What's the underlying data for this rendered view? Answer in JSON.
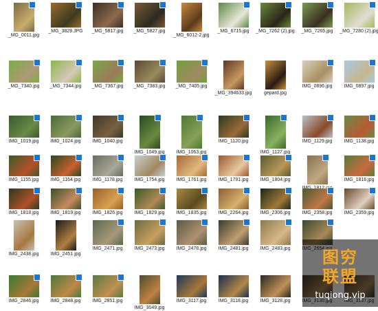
{
  "files": [
    {
      "name": "_MG_0011.jpg",
      "badge": true,
      "c1": "#7b6a45",
      "c2": "#c9ad6e"
    },
    {
      "name": "_MG_3829.JPG",
      "badge": true,
      "c1": "#9b6a2c",
      "c2": "#3c3a1f"
    },
    {
      "name": "_MG_5817.jpg",
      "badge": true,
      "c1": "#3a2f23",
      "c2": "#8d6a4c"
    },
    {
      "name": "_MG_5827.jpg",
      "badge": true,
      "c1": "#7a5a36",
      "c2": "#2a2a20"
    },
    {
      "name": "_MG_6012-2.jpg",
      "badge": false,
      "c1": "#c8893c",
      "c2": "#5b3a1d"
    },
    {
      "name": "_MG_6715.jpg",
      "badge": true,
      "c1": "#5c8a48",
      "c2": "#e8e6d8"
    },
    {
      "name": "_MG_7262 (2).jpg",
      "badge": true,
      "c1": "#6a8a3a",
      "c2": "#2a2418"
    },
    {
      "name": "_MG_7265.jpg",
      "badge": true,
      "c1": "#7a9a50",
      "c2": "#3a3020"
    },
    {
      "name": "_MG_7280 (2).jpg",
      "badge": true,
      "c1": "#a8b860",
      "c2": "#e0ddd0"
    },
    {
      "name": "_MG_7340.jpg",
      "badge": true,
      "c1": "#78b040",
      "c2": "#b09878"
    },
    {
      "name": "_MG_7344.jpg",
      "badge": true,
      "c1": "#88b84a",
      "c2": "#d8c8b8"
    },
    {
      "name": "_MG_7367.jpg",
      "badge": true,
      "c1": "#7aa848",
      "c2": "#9a7a58"
    },
    {
      "name": "_MG_7383.jpg",
      "badge": true,
      "c1": "#5a4a30",
      "c2": "#9a8a60"
    },
    {
      "name": "_MG_7405.jpg",
      "badge": true,
      "c1": "#70a040",
      "c2": "#a08a60"
    },
    {
      "name": "_MG_394633.jpg",
      "badge": false,
      "c1": "#5a3820",
      "c2": "#c89860"
    },
    {
      "name": "gepard.jpg",
      "badge": false,
      "c1": "#c89040",
      "c2": "#2a1a10"
    },
    {
      "name": "IMG_0896.jpg",
      "badge": true,
      "c1": "#d8d0c0",
      "c2": "#a89060"
    },
    {
      "name": "IMG_0897.jpg",
      "badge": true,
      "c1": "#a8c8e0",
      "c2": "#c8b890"
    },
    {
      "name": "IMG_1019.jpg",
      "badge": true,
      "c1": "#3a5a30",
      "c2": "#6a8a48"
    },
    {
      "name": "IMG_1024.jpg",
      "badge": true,
      "c1": "#4a6a38",
      "c2": "#8a9a60"
    },
    {
      "name": "IMG_1040.jpg",
      "badge": true,
      "c1": "#3a3a28",
      "c2": "#7a6040"
    },
    {
      "name": "IMG_1049.jpg",
      "badge": true,
      "c1": "#2a4a20",
      "c2": "#6a8a40"
    },
    {
      "name": "IMG_1063.jpg",
      "badge": true,
      "c1": "#4a7a30",
      "c2": "#8aa058"
    },
    {
      "name": "IMG_1120.jpg",
      "badge": true,
      "c1": "#2a3a20",
      "c2": "#9a6a38"
    },
    {
      "name": "IMG_1127.jpg",
      "badge": true,
      "c1": "#3a6a28",
      "c2": "#8ab060"
    },
    {
      "name": "IMG_1129.jpg",
      "badge": true,
      "c1": "#b8c0c8",
      "c2": "#8a4a28"
    },
    {
      "name": "IMG_1138.jpg",
      "badge": true,
      "c1": "#6a8a48",
      "c2": "#b85a30"
    },
    {
      "name": "IMG_1155.jpg",
      "badge": true,
      "c1": "#3a5a28",
      "c2": "#b8502a"
    },
    {
      "name": "IMG_1164.jpg",
      "badge": true,
      "c1": "#2a4a20",
      "c2": "#c86030"
    },
    {
      "name": "IMG_1178.jpg",
      "badge": true,
      "c1": "#6a6a60",
      "c2": "#a8a898"
    },
    {
      "name": "IMG_1754.jpg",
      "badge": true,
      "c1": "#c8d0d0",
      "c2": "#a08860"
    },
    {
      "name": "IMG_1761.jpg",
      "badge": true,
      "c1": "#a86a30",
      "c2": "#e0b880"
    },
    {
      "name": "IMG_1791.jpg",
      "badge": true,
      "c1": "#9a5a30",
      "c2": "#e8c8a0"
    },
    {
      "name": "IMG_1804.jpg",
      "badge": true,
      "c1": "#5a5a30",
      "c2": "#b89858"
    },
    {
      "name": "IMG_1812.jpg",
      "badge": true,
      "c1": "#8a7050",
      "c2": "#c0a880"
    },
    {
      "name": "IMG_1816.jpg",
      "badge": true,
      "c1": "#5a7a38",
      "c2": "#c86a40"
    },
    {
      "name": "IMG_1818.jpg",
      "badge": true,
      "c1": "#2a3a20",
      "c2": "#b05028"
    },
    {
      "name": "IMG_1819.jpg",
      "badge": true,
      "c1": "#3a5028",
      "c2": "#c88a60"
    },
    {
      "name": "IMG_1826.jpg",
      "badge": true,
      "c1": "#9a6028",
      "c2": "#d8a050"
    },
    {
      "name": "IMG_1829.jpg",
      "badge": true,
      "c1": "#3a5a28",
      "c2": "#b08858"
    },
    {
      "name": "IMG_1835.jpg",
      "badge": true,
      "c1": "#a88840",
      "c2": "#5a4a20"
    },
    {
      "name": "IMG_2264.jpg",
      "badge": true,
      "c1": "#8a6030",
      "c2": "#d8b070"
    },
    {
      "name": "IMG_2306.jpg",
      "badge": true,
      "c1": "#1a2a18",
      "c2": "#a07838"
    },
    {
      "name": "IMG_2358.jpg",
      "badge": true,
      "c1": "#4a5a30",
      "c2": "#c07848"
    },
    {
      "name": "IMG_2359.jpg",
      "badge": true,
      "c1": "#6a4a30",
      "c2": "#e0d0c0"
    },
    {
      "name": "IMG_2438.jpg",
      "badge": false,
      "c1": "#c8c0b0",
      "c2": "#a87840"
    },
    {
      "name": "IMG_2451.jpg",
      "badge": false,
      "c1": "#1a1a18",
      "c2": "#b08040"
    },
    {
      "name": "IMG_2471.jpg",
      "badge": true,
      "c1": "#5a6a50",
      "c2": "#a89878"
    },
    {
      "name": "IMG_2473.jpg",
      "badge": true,
      "c1": "#6a6a40",
      "c2": "#c8a060"
    },
    {
      "name": "IMG_2478.jpg",
      "badge": true,
      "c1": "#5a5a48",
      "c2": "#b09070"
    },
    {
      "name": "IMG_2481.jpg",
      "badge": true,
      "c1": "#3a3a30",
      "c2": "#c0a070"
    },
    {
      "name": "IMG_2483.jpg",
      "badge": true,
      "c1": "#8a7a50",
      "c2": "#d8b888"
    },
    {
      "name": "IMG_2654.jpg",
      "badge": true,
      "c1": "#3a4a30",
      "c2": "#a88858"
    },
    {
      "name": "",
      "badge": false,
      "c1": "#ffffff",
      "c2": "#ffffff"
    },
    {
      "name": "IMG_2846.jpg",
      "badge": true,
      "c1": "#3a7a30",
      "c2": "#a87838"
    },
    {
      "name": "IMG_2848.jpg",
      "badge": true,
      "c1": "#4a7a38",
      "c2": "#c08848"
    },
    {
      "name": "IMG_2851.jpg",
      "badge": true,
      "c1": "#5a7a40",
      "c2": "#c09050"
    },
    {
      "name": "IMG_3049.jpg",
      "badge": false,
      "c1": "#4a5030",
      "c2": "#c08040"
    },
    {
      "name": "IMG_3117.jpg",
      "badge": false,
      "c1": "#1a3a58",
      "c2": "#a87838"
    },
    {
      "name": "IMG_3118.jpg",
      "badge": false,
      "c1": "#1a3050",
      "c2": "#b08848"
    },
    {
      "name": "IMG_3128.jpg",
      "badge": false,
      "c1": "#2a2a20",
      "c2": "#c09058"
    },
    {
      "name": "IMG_3130.jpg",
      "badge": false,
      "c1": "#3a3a28",
      "c2": "#a88050"
    },
    {
      "name": "IMG_3137.jpg",
      "badge": false,
      "c1": "#3a3a30",
      "c2": "#a88058"
    }
  ],
  "watermark": {
    "title": "图穷",
    "subtitle": "联盟",
    "url": "tuqiong.vip"
  }
}
